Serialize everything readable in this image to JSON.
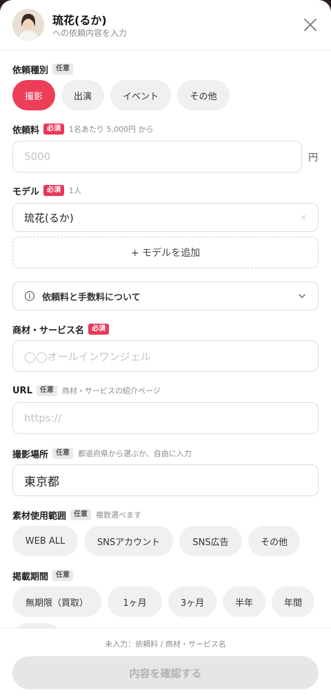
{
  "header": {
    "name": "琉花(るか)",
    "subtitle": "への依頼内容を入力"
  },
  "request_type": {
    "label": "依頼種別",
    "badge": "任意",
    "options": [
      "撮影",
      "出演",
      "イベント",
      "その他"
    ],
    "selected": "撮影"
  },
  "fee": {
    "label": "依頼料",
    "badge": "必須",
    "hint": "1名あたり 5,000円 から",
    "placeholder": "5000",
    "unit": "円"
  },
  "model": {
    "label": "モデル",
    "badge": "必須",
    "hint": "1人",
    "value": "琉花(るか)",
    "add_label": "+ モデルを追加"
  },
  "fee_info": {
    "label": "依頼料と手数料について"
  },
  "product": {
    "label": "商材・サービス名",
    "badge": "必須",
    "placeholder": "◯◯オールインワンジェル"
  },
  "url": {
    "label": "URL",
    "badge": "任意",
    "hint": "商材・サービスの紹介ページ",
    "placeholder": "https://"
  },
  "location": {
    "label": "撮影場所",
    "badge": "任意",
    "hint": "都道府県から選ぶか、自由に入力",
    "value": "東京都"
  },
  "usage": {
    "label": "素材使用範囲",
    "badge": "任意",
    "hint": "複数選べます",
    "options": [
      "WEB ALL",
      "SNSアカウント",
      "SNS広告",
      "その他"
    ]
  },
  "period": {
    "label": "掲載期間",
    "badge": "任意",
    "options": [
      "無期限（買取）",
      "1ヶ月",
      "3ヶ月",
      "半年",
      "年間"
    ]
  },
  "footer": {
    "missing": "未入力：依頼料 / 商材・サービス名",
    "confirm_label": "内容を確認する"
  },
  "colors": {
    "accent": "#ec3d59",
    "required_badge": "#e8385a"
  }
}
